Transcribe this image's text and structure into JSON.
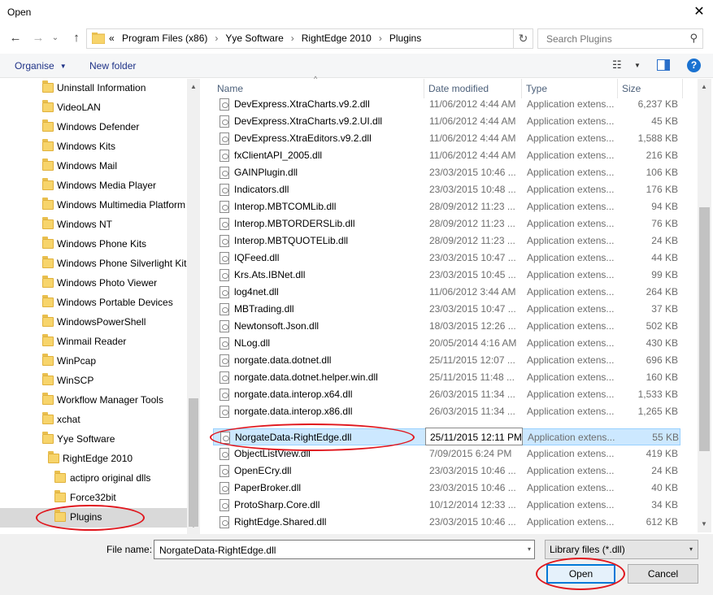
{
  "window": {
    "title": "Open",
    "close_glyph": "✕"
  },
  "nav": {
    "back_glyph": "←",
    "forward_glyph": "→",
    "recent_glyph": "⌄",
    "up_glyph": "↑",
    "breadcrumb": [
      "«",
      "Program Files (x86)",
      "Yye Software",
      "RightEdge 2010",
      "Plugins"
    ],
    "breadcrumb_sep": "›",
    "refresh_glyph": "↻",
    "search_placeholder": "Search Plugins",
    "search_glyph": "⚲"
  },
  "toolbar": {
    "organise": "Organise",
    "caret": "▼",
    "new_folder": "New folder",
    "view_glyph": "☷",
    "help_glyph": "?"
  },
  "sidebar": {
    "items": [
      {
        "label": "Uninstall Information"
      },
      {
        "label": "VideoLAN"
      },
      {
        "label": "Windows Defender"
      },
      {
        "label": "Windows Kits"
      },
      {
        "label": "Windows Mail"
      },
      {
        "label": "Windows Media Player"
      },
      {
        "label": "Windows Multimedia Platform"
      },
      {
        "label": "Windows NT"
      },
      {
        "label": "Windows Phone Kits"
      },
      {
        "label": "Windows Phone Silverlight Kit"
      },
      {
        "label": "Windows Photo Viewer"
      },
      {
        "label": "Windows Portable Devices"
      },
      {
        "label": "WindowsPowerShell"
      },
      {
        "label": "Winmail Reader"
      },
      {
        "label": "WinPcap"
      },
      {
        "label": "WinSCP"
      },
      {
        "label": "Workflow Manager Tools"
      },
      {
        "label": "xchat"
      },
      {
        "label": "Yye Software"
      },
      {
        "label": "RightEdge 2010"
      },
      {
        "label": "actipro original dlls"
      },
      {
        "label": "Force32bit"
      },
      {
        "label": "Plugins"
      }
    ]
  },
  "columns": {
    "name": "Name",
    "date": "Date modified",
    "type": "Type",
    "size": "Size",
    "sort_glyph": "^"
  },
  "files": [
    {
      "name": "DevExpress.XtraCharts.v9.2.dll",
      "date": "11/06/2012 4:44 AM",
      "type": "Application extens...",
      "size": "6,237 KB"
    },
    {
      "name": "DevExpress.XtraCharts.v9.2.UI.dll",
      "date": "11/06/2012 4:44 AM",
      "type": "Application extens...",
      "size": "45 KB"
    },
    {
      "name": "DevExpress.XtraEditors.v9.2.dll",
      "date": "11/06/2012 4:44 AM",
      "type": "Application extens...",
      "size": "1,588 KB"
    },
    {
      "name": "fxClientAPI_2005.dll",
      "date": "11/06/2012 4:44 AM",
      "type": "Application extens...",
      "size": "216 KB"
    },
    {
      "name": "GAINPlugin.dll",
      "date": "23/03/2015 10:46 ...",
      "type": "Application extens...",
      "size": "106 KB"
    },
    {
      "name": "Indicators.dll",
      "date": "23/03/2015 10:48 ...",
      "type": "Application extens...",
      "size": "176 KB"
    },
    {
      "name": "Interop.MBTCOMLib.dll",
      "date": "28/09/2012 11:23 ...",
      "type": "Application extens...",
      "size": "94 KB"
    },
    {
      "name": "Interop.MBTORDERSLib.dll",
      "date": "28/09/2012 11:23 ...",
      "type": "Application extens...",
      "size": "76 KB"
    },
    {
      "name": "Interop.MBTQUOTELib.dll",
      "date": "28/09/2012 11:23 ...",
      "type": "Application extens...",
      "size": "24 KB"
    },
    {
      "name": "IQFeed.dll",
      "date": "23/03/2015 10:47 ...",
      "type": "Application extens...",
      "size": "44 KB"
    },
    {
      "name": "Krs.Ats.IBNet.dll",
      "date": "23/03/2015 10:45 ...",
      "type": "Application extens...",
      "size": "99 KB"
    },
    {
      "name": "log4net.dll",
      "date": "11/06/2012 3:44 AM",
      "type": "Application extens...",
      "size": "264 KB"
    },
    {
      "name": "MBTrading.dll",
      "date": "23/03/2015 10:47 ...",
      "type": "Application extens...",
      "size": "37 KB"
    },
    {
      "name": "Newtonsoft.Json.dll",
      "date": "18/03/2015 12:26 ...",
      "type": "Application extens...",
      "size": "502 KB"
    },
    {
      "name": "NLog.dll",
      "date": "20/05/2014 4:16 AM",
      "type": "Application extens...",
      "size": "430 KB"
    },
    {
      "name": "norgate.data.dotnet.dll",
      "date": "25/11/2015 12:07 ...",
      "type": "Application extens...",
      "size": "696 KB"
    },
    {
      "name": "norgate.data.dotnet.helper.win.dll",
      "date": "25/11/2015 11:48 ...",
      "type": "Application extens...",
      "size": "160 KB"
    },
    {
      "name": "norgate.data.interop.x64.dll",
      "date": "26/03/2015 11:34 ...",
      "type": "Application extens...",
      "size": "1,533 KB"
    },
    {
      "name": "norgate.data.interop.x86.dll",
      "date": "26/03/2015 11:34 ...",
      "type": "Application extens...",
      "size": "1,265 KB"
    },
    {
      "name": "NorgateData-RightEdge.dll",
      "date": "25/11/2015 12:11 PM",
      "type": "Application extens...",
      "size": "55 KB",
      "selected": true
    },
    {
      "name": "ObjectListView.dll",
      "date": "7/09/2015 6:24 PM",
      "type": "Application extens...",
      "size": "419 KB"
    },
    {
      "name": "OpenECry.dll",
      "date": "23/03/2015 10:46 ...",
      "type": "Application extens...",
      "size": "24 KB"
    },
    {
      "name": "PaperBroker.dll",
      "date": "23/03/2015 10:46 ...",
      "type": "Application extens...",
      "size": "40 KB"
    },
    {
      "name": "ProtoSharp.Core.dll",
      "date": "10/12/2014 12:33 ...",
      "type": "Application extens...",
      "size": "34 KB"
    },
    {
      "name": "RightEdge.Shared.dll",
      "date": "23/03/2015 10:46 ...",
      "type": "Application extens...",
      "size": "612 KB"
    }
  ],
  "footer": {
    "file_name_label": "File name:",
    "file_name_value": "NorgateData-RightEdge.dll",
    "filter_value": "Library files (*.dll)",
    "open_label": "Open",
    "cancel_label": "Cancel",
    "dd_glyph": "▾"
  },
  "colors": {
    "annotation": "#e0161d",
    "selection": "#cce8ff",
    "accent": "#0078d7"
  }
}
